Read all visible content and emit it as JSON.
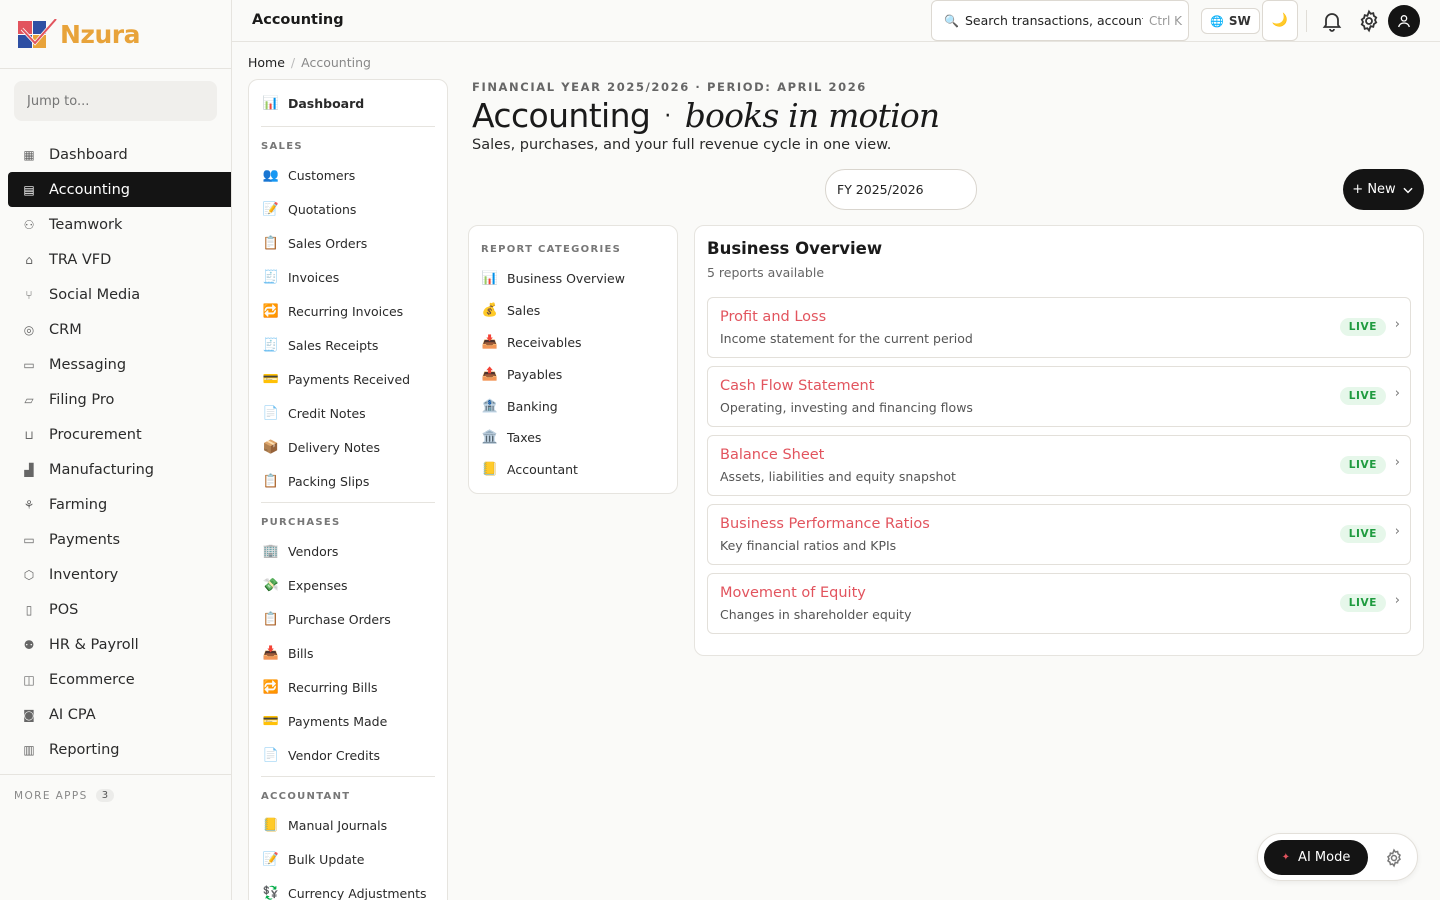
{
  "brand": {
    "name": "Nzura",
    "colors": {
      "red": "#e2545e",
      "blue": "#2e4fa3",
      "gold": "#e8a33a"
    }
  },
  "sidebar": {
    "jump_placeholder": "Jump to...",
    "items": [
      {
        "label": "Dashboard",
        "icon": "grid-icon"
      },
      {
        "label": "Accounting",
        "icon": "ledger-icon",
        "active": true
      },
      {
        "label": "Teamwork",
        "icon": "people-icon"
      },
      {
        "label": "TRA VFD",
        "icon": "bank-icon"
      },
      {
        "label": "Social Media",
        "icon": "share-icon"
      },
      {
        "label": "CRM",
        "icon": "contact-icon"
      },
      {
        "label": "Messaging",
        "icon": "chat-icon"
      },
      {
        "label": "Filing Pro",
        "icon": "folder-icon"
      },
      {
        "label": "Procurement",
        "icon": "cart-icon"
      },
      {
        "label": "Manufacturing",
        "icon": "factory-icon"
      },
      {
        "label": "Farming",
        "icon": "plant-icon"
      },
      {
        "label": "Payments",
        "icon": "card-icon"
      },
      {
        "label": "Inventory",
        "icon": "box-icon"
      },
      {
        "label": "POS",
        "icon": "receipt-icon"
      },
      {
        "label": "HR & Payroll",
        "icon": "user-x-icon"
      },
      {
        "label": "Ecommerce",
        "icon": "bag-icon"
      },
      {
        "label": "AI CPA",
        "icon": "bot-icon"
      },
      {
        "label": "Reporting",
        "icon": "bar-chart-icon"
      }
    ],
    "more_apps_label": "MORE APPS",
    "more_apps_count": "3"
  },
  "topbar": {
    "title": "Accounting",
    "search_text": "Search transactions, accounts...",
    "search_kbd": "Ctrl K",
    "lang": "SW"
  },
  "breadcrumb": {
    "home": "Home",
    "current": "Accounting"
  },
  "subnav": {
    "dashboard": {
      "label": "Dashboard",
      "emoji": "📊"
    },
    "sections": [
      {
        "title": "SALES",
        "items": [
          {
            "label": "Customers",
            "emoji": "👥"
          },
          {
            "label": "Quotations",
            "emoji": "📝"
          },
          {
            "label": "Sales Orders",
            "emoji": "📋"
          },
          {
            "label": "Invoices",
            "emoji": "🧾"
          },
          {
            "label": "Recurring Invoices",
            "emoji": "🔁"
          },
          {
            "label": "Sales Receipts",
            "emoji": "🧾"
          },
          {
            "label": "Payments Received",
            "emoji": "💳"
          },
          {
            "label": "Credit Notes",
            "emoji": "📄"
          },
          {
            "label": "Delivery Notes",
            "emoji": "📦"
          },
          {
            "label": "Packing Slips",
            "emoji": "📋"
          }
        ]
      },
      {
        "title": "PURCHASES",
        "items": [
          {
            "label": "Vendors",
            "emoji": "🏢"
          },
          {
            "label": "Expenses",
            "emoji": "💸"
          },
          {
            "label": "Purchase Orders",
            "emoji": "📋"
          },
          {
            "label": "Bills",
            "emoji": "📥"
          },
          {
            "label": "Recurring Bills",
            "emoji": "🔁"
          },
          {
            "label": "Payments Made",
            "emoji": "💳"
          },
          {
            "label": "Vendor Credits",
            "emoji": "📄"
          }
        ]
      },
      {
        "title": "ACCOUNTANT",
        "items": [
          {
            "label": "Manual Journals",
            "emoji": "📒"
          },
          {
            "label": "Bulk Update",
            "emoji": "📝"
          },
          {
            "label": "Currency Adjustments",
            "emoji": "💱"
          }
        ]
      }
    ]
  },
  "header": {
    "eyebrow": "FINANCIAL YEAR 2025/2026 · PERIOD: APRIL 2026",
    "title": "Accounting",
    "title_dot": "·",
    "title_italic": "books in motion",
    "subtitle": "Sales, purchases, and your full revenue cycle in one view.",
    "fy_value": "FY 2025/2026",
    "new_label": "+ New"
  },
  "categories": {
    "title": "REPORT CATEGORIES",
    "items": [
      {
        "label": "Business Overview",
        "emoji": "📊"
      },
      {
        "label": "Sales",
        "emoji": "💰"
      },
      {
        "label": "Receivables",
        "emoji": "📥"
      },
      {
        "label": "Payables",
        "emoji": "📤"
      },
      {
        "label": "Banking",
        "emoji": "🏦"
      },
      {
        "label": "Taxes",
        "emoji": "🏛️"
      },
      {
        "label": "Accountant",
        "emoji": "📒"
      }
    ]
  },
  "overview": {
    "title": "Business Overview",
    "count_text": "5 reports available",
    "reports": [
      {
        "name": "Profit and Loss",
        "desc": "Income statement for the current period",
        "badge": "LIVE"
      },
      {
        "name": "Cash Flow Statement",
        "desc": "Operating, investing and financing flows",
        "badge": "LIVE"
      },
      {
        "name": "Balance Sheet",
        "desc": "Assets, liabilities and equity snapshot",
        "badge": "LIVE"
      },
      {
        "name": "Business Performance Ratios",
        "desc": "Key financial ratios and KPIs",
        "badge": "LIVE"
      },
      {
        "name": "Movement of Equity",
        "desc": "Changes in shareholder equity",
        "badge": "LIVE"
      }
    ]
  },
  "ai": {
    "label": "AI Mode"
  }
}
